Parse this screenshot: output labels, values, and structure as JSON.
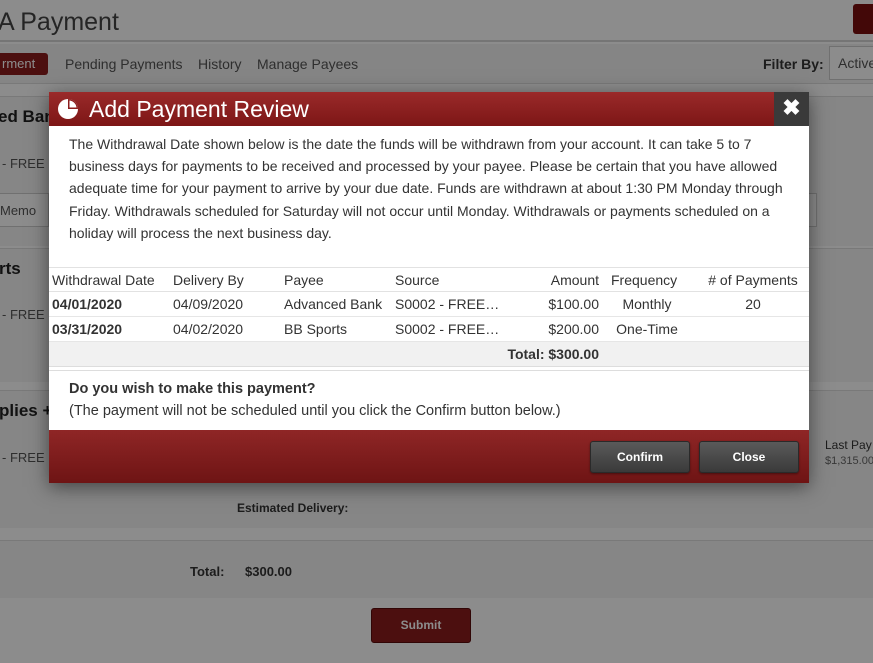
{
  "background": {
    "page_title": "A Payment",
    "tabs": {
      "active": "rment",
      "pending": "Pending Payments",
      "history": "History",
      "manage": "Manage Payees"
    },
    "filter": {
      "label": "Filter By:",
      "value": "Active"
    },
    "section1": {
      "heading": "ed Ban",
      "account": "- FREE",
      "memo_placeholder": "Memo"
    },
    "section2": {
      "heading": "rts",
      "account": "- FREE"
    },
    "section3": {
      "heading": "plies +",
      "account": "- FREE"
    },
    "last_pay": {
      "label": "Last Pay",
      "amount": "$1,315.00"
    },
    "estimated_delivery_label": "Estimated Delivery:",
    "total": {
      "label": "Total:",
      "value": "$300.00"
    },
    "submit_label": "Submit"
  },
  "modal": {
    "title": "Add Payment Review",
    "close_glyph": "✖",
    "intro": "The Withdrawal Date shown below is the date the funds will be withdrawn from your account. It can take 5 to 7 business days for payments to be received and processed by your payee. Please be certain that you have allowed adequate time for your payment to arrive by your due date. Funds are withdrawn at about 1:30 PM Monday through Friday. Withdrawals scheduled for Saturday will not occur until Monday. Withdrawals or payments scheduled on a holiday will process the next business day.",
    "table": {
      "headers": {
        "withdrawal_date": "Withdrawal Date",
        "delivery_by": "Delivery By",
        "payee": "Payee",
        "source": "Source",
        "amount": "Amount",
        "frequency": "Frequency",
        "num_payments": "# of Payments"
      },
      "rows": [
        {
          "withdrawal_date": "04/01/2020",
          "delivery_by": "04/09/2020",
          "payee": "Advanced Bank",
          "source": "S0002 - FREE…",
          "amount": "$100.00",
          "frequency": "Monthly",
          "num_payments": "20"
        },
        {
          "withdrawal_date": "03/31/2020",
          "delivery_by": "04/02/2020",
          "payee": "BB Sports",
          "source": "S0002 - FREE…",
          "amount": "$200.00",
          "frequency": "One-Time",
          "num_payments": ""
        }
      ],
      "total": "Total: $300.00"
    },
    "question": "Do you wish to make this payment?",
    "note": "(The payment will not be scheduled until you click the Confirm button below.)",
    "confirm_label": "Confirm",
    "close_label": "Close"
  },
  "colors": {
    "header_red": "#8b1c1c",
    "withdrawal_red": "#dd1111",
    "button_dark": "#444444"
  }
}
